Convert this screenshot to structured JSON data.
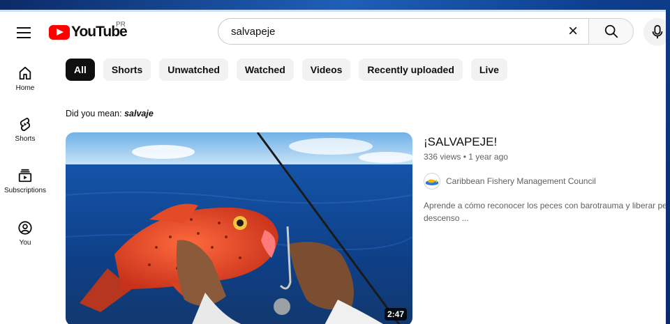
{
  "header": {
    "logo_text": "YouTube",
    "country_code": "PR",
    "search_value": "salvapeje",
    "clear_symbol": "×"
  },
  "sidebar": {
    "items": [
      {
        "label": "Home",
        "icon": "home-icon"
      },
      {
        "label": "Shorts",
        "icon": "shorts-icon"
      },
      {
        "label": "Subscriptions",
        "icon": "subscriptions-icon"
      },
      {
        "label": "You",
        "icon": "you-icon"
      }
    ]
  },
  "chips": [
    "All",
    "Shorts",
    "Unwatched",
    "Watched",
    "Videos",
    "Recently uploaded",
    "Live"
  ],
  "did_you_mean": {
    "prefix": "Did you mean: ",
    "suggestion": "salvaje"
  },
  "video": {
    "title": "¡SALVAPEJE!",
    "meta": "336 views • 1 year ago",
    "channel": "Caribbean Fishery Management Council",
    "description_line1": "Aprende a cómo reconocer los peces con barotrauma y liberar pe",
    "description_line2": "descenso ...",
    "duration": "2:47"
  },
  "colors": {
    "brand_red": "#ff0000",
    "active_chip": "#0f0f0f",
    "chip_bg": "#f2f2f2"
  }
}
